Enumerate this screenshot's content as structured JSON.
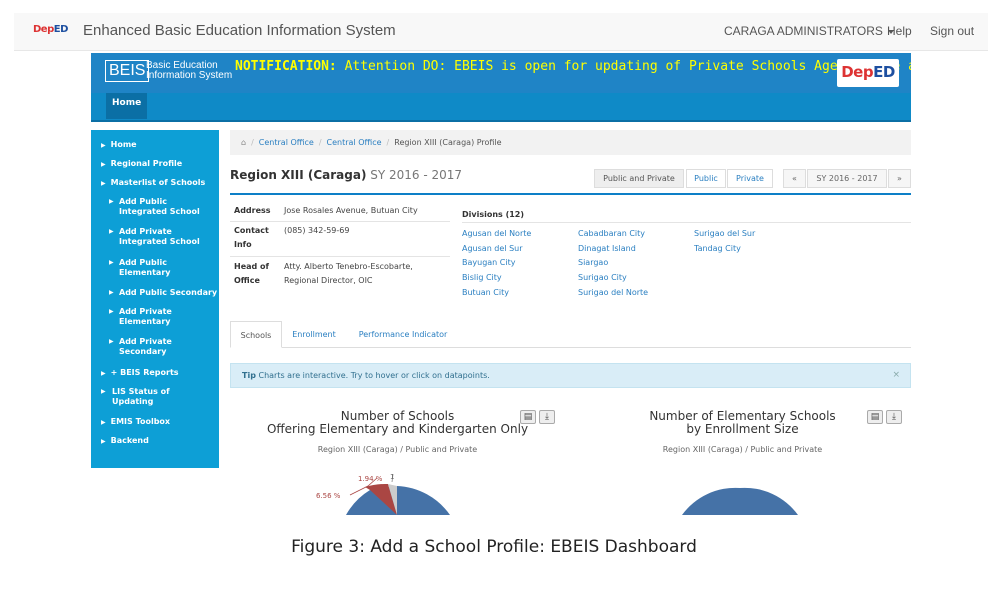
{
  "navbar": {
    "logo_prefix": "Dep",
    "logo_suffix": "ED",
    "brand": "Enhanced Basic Education Information System",
    "user": "CARAGA ADMINISTRATORS",
    "help": "Help",
    "signout": "Sign out"
  },
  "banner": {
    "beis": "BEIS",
    "beis_sub_line1": "Basic Education",
    "beis_sub_line2": "Information System",
    "notification_label": "NOTIFICATION:",
    "notification_text": " Attention DO: EBEIS is open for updating of Private Schools Age Profile at the Division level.",
    "deped_prefix": "Dep",
    "deped_suffix": "ED"
  },
  "menubar": {
    "home": "Home"
  },
  "sidebar": {
    "items": [
      {
        "label": "Home"
      },
      {
        "label": "Regional Profile"
      },
      {
        "label": "Masterlist of Schools"
      },
      {
        "label": "Add Public Integrated School"
      },
      {
        "label": "Add Private Integrated School"
      },
      {
        "label": "Add Public Elementary"
      },
      {
        "label": "Add Public Secondary"
      },
      {
        "label": "Add Private Elementary"
      },
      {
        "label": "Add Private Secondary"
      },
      {
        "label": "+ BEIS Reports"
      },
      {
        "label": "LIS Status of Updating"
      },
      {
        "label": "EMIS Toolbox"
      },
      {
        "label": "Backend"
      }
    ]
  },
  "breadcrumb": {
    "home_icon": "home-icon",
    "items": [
      "Central Office",
      "Central Office",
      "Region XIII (Caraga) Profile"
    ]
  },
  "profile": {
    "region": "Region XIII (Caraga)",
    "sy": " SY 2016 - 2017",
    "filters": [
      "Public and Private",
      "Public",
      "Private"
    ],
    "prev": "«",
    "sy_btn": "SY 2016 - 2017",
    "next": "»",
    "address_label": "Address",
    "address": "Jose Rosales Avenue, Butuan City",
    "contact_label_1": "Contact",
    "contact_label_2": "Info",
    "contact": "(085) 342-59-69",
    "head_label_1": "Head of",
    "head_label_2": "Office",
    "head_1": "Atty. Alberto Tenebro-Escobarte,",
    "head_2": "Regional Director, OIC",
    "divisions_title": "Divisions (12)",
    "divisions": [
      "Agusan del Norte",
      "Agusan del Sur",
      "Bayugan City",
      "Bislig City",
      "Butuan City",
      "Cabadbaran City",
      "Dinagat Island",
      "Siargao",
      "Surigao City",
      "Surigao del Norte",
      "Surigao del Sur",
      "Tandag City"
    ]
  },
  "tabs": [
    "Schools",
    "Enrollment",
    "Performance Indicator"
  ],
  "tip": {
    "label": "Tip",
    "text": " Charts are interactive. Try to hover or click on datapoints.",
    "close": "×"
  },
  "charts": [
    {
      "title_1": "Number of Schools",
      "title_2": "Offering Elementary and Kindergarten Only",
      "subtitle": "Region XIII (Caraga) / Public and Private",
      "labels": [
        "6.56 %",
        "1.94 %",
        "1"
      ]
    },
    {
      "title_1": "Number of Elementary Schools",
      "title_2": "by Enrollment Size",
      "subtitle": "Region XIII (Caraga) / Public and Private"
    }
  ],
  "caption": "Figure 3: Add a School Profile: EBEIS Dashboard",
  "colors": {
    "accent": "#1f84c6",
    "sidebar": "#0d9fd6",
    "pie_blue": "#4572a7",
    "pie_red": "#aa4643"
  }
}
